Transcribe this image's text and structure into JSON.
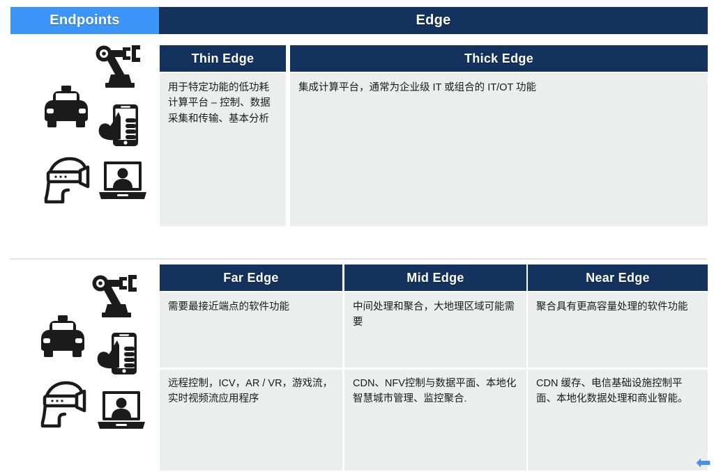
{
  "colors": {
    "navy": "#13335e",
    "light_blue": "#3d96f7",
    "panel_bg": "#eceded",
    "page_bg": "#ffffff"
  },
  "top_section": {
    "column_headers": [
      {
        "label": "Endpoints",
        "style": "blue"
      },
      {
        "label": "Edge",
        "style": "navy"
      }
    ],
    "sub_headers": [
      {
        "label": "Thin Edge"
      },
      {
        "label": "Thick Edge"
      }
    ],
    "cells": [
      {
        "text": "用于特定功能的低功耗计算平台 – 控制、数据采集和传输、基本分析"
      },
      {
        "text": "集成计算平台，通常为企业级 IT 或组合的 IT/OT 功能"
      }
    ],
    "icons": [
      "robotic-arm-icon",
      "taxi-car-icon",
      "hand-smartphone-icon",
      "vr-headset-icon",
      "laptop-person-icon"
    ]
  },
  "bottom_section": {
    "sub_headers": [
      {
        "label": "Far Edge"
      },
      {
        "label": "Mid Edge"
      },
      {
        "label": "Near Edge"
      }
    ],
    "row_one": [
      {
        "text": "需要最接近端点的软件功能"
      },
      {
        "text": "中间处理和聚合，大地理区域可能需要"
      },
      {
        "text": "聚合具有更高容量处理的软件功能"
      }
    ],
    "row_two": [
      {
        "text": "远程控制，ICV，AR / VR，游戏流，实时视频流应用程序"
      },
      {
        "text": "CDN、NFV控制与数据平面、本地化智慧城市管理、监控聚合."
      },
      {
        "text": "CDN 缓存、电信基础设施控制平面、本地化数据处理和商业智能。"
      }
    ],
    "icons": [
      "robotic-arm-icon",
      "taxi-car-icon",
      "hand-smartphone-icon",
      "vr-headset-icon",
      "laptop-person-icon"
    ]
  },
  "corner": {
    "arrow_glyph": "⬅"
  }
}
